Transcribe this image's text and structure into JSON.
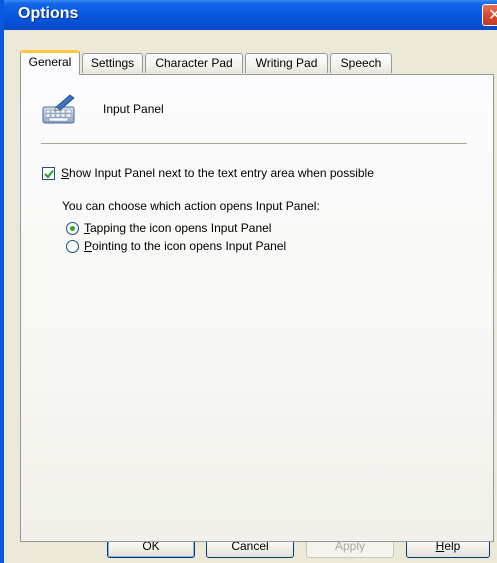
{
  "window": {
    "title": "Options",
    "close_glyph": "✕"
  },
  "tabs": [
    {
      "label": "General",
      "active": true
    },
    {
      "label": "Settings",
      "active": false
    },
    {
      "label": "Character Pad",
      "active": false
    },
    {
      "label": "Writing Pad",
      "active": false
    },
    {
      "label": "Speech",
      "active": false
    }
  ],
  "general": {
    "icon": "input-panel-icon",
    "heading": "Input Panel",
    "show_panel": {
      "checked": true,
      "accel": "S",
      "label_rest": "how Input Panel next to the text entry area when possible"
    },
    "hint": "You can choose which action opens Input Panel:",
    "radios": [
      {
        "accel": "T",
        "label_rest": "apping the icon opens Input Panel",
        "selected": true
      },
      {
        "accel": "P",
        "label_rest": "ointing to the icon opens Input Panel",
        "selected": false
      }
    ]
  },
  "buttons": {
    "ok": "OK",
    "cancel": "Cancel",
    "apply": "Apply",
    "help_accel": "H",
    "help_rest": "elp"
  },
  "colors": {
    "titlebar": "#0a5ae0",
    "radio_dot": "#2fa12b",
    "active_tab_highlight": "#ffc83c"
  }
}
